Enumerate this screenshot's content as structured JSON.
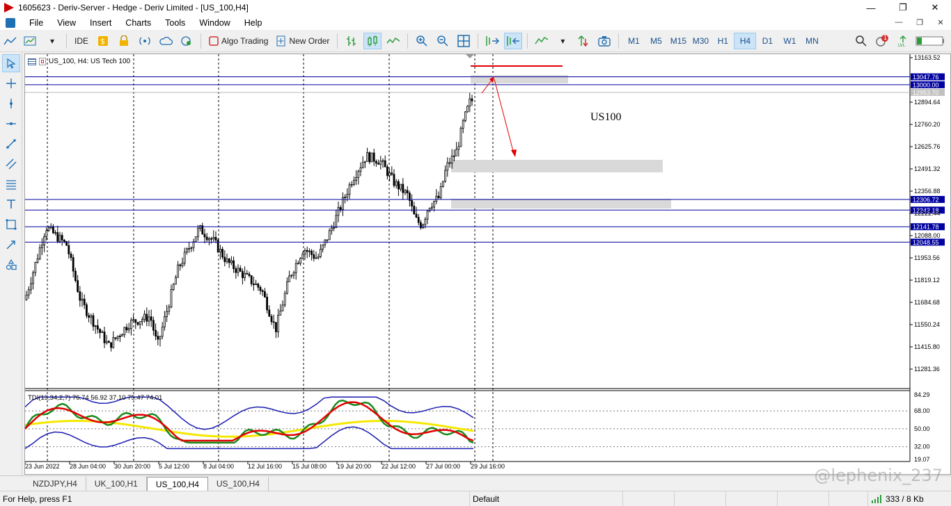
{
  "window": {
    "title": "1605623 - Deriv-Server - Hedge - Deriv Limited - [US_100,H4]"
  },
  "menu": [
    "File",
    "View",
    "Insert",
    "Charts",
    "Tools",
    "Window",
    "Help"
  ],
  "toolbar": {
    "ide_label": "IDE",
    "algo_label": "Algo Trading",
    "new_order_label": "New Order",
    "timeframes": [
      "M1",
      "M5",
      "M15",
      "M30",
      "H1",
      "H4",
      "D1",
      "W1",
      "MN"
    ],
    "active_timeframe": "H4",
    "notification_count": "1"
  },
  "chart": {
    "header": "US_100, H4:  US Tech 100",
    "annotation": "US100",
    "price_labels": [
      "13163.52",
      "12894.64",
      "12760.20",
      "12625.76",
      "12491.32",
      "12356.88",
      "12222.44",
      "12088.00",
      "11953.56",
      "11819.12",
      "11684.68",
      "11550.24",
      "11415.80",
      "11281.36"
    ],
    "line_labels": [
      "13047.76",
      "13000.00",
      "12953.70",
      "12306.72",
      "12242.18",
      "12141.78",
      "12048.55"
    ],
    "time_labels": [
      "23 Jun 2022",
      "28 Jun 04:00",
      "30 Jun 20:00",
      "5 Jul 12:00",
      "8 Jul 04:00",
      "12 Jul 16:00",
      "15 Jul 08:00",
      "19 Jul 20:00",
      "22 Jul 12:00",
      "27 Jul 00:00",
      "29 Jul 16:00"
    ],
    "indicator_header": "TDI(13,34,2,7) 76.74 56.92 37.10 75.47 74.01",
    "indicator_levels": [
      "84.29",
      "68.00",
      "50.00",
      "32.00",
      "19.07"
    ],
    "colors": {
      "hline": "#0000a0",
      "arrow": "#e00000",
      "zone": "#d9d9d9",
      "candle": "#000000"
    }
  },
  "tabs": [
    "NZDJPY,H4",
    "UK_100,H1",
    "US_100,H4",
    "US_100,H4"
  ],
  "active_tab": 2,
  "status": {
    "help": "For Help, press F1",
    "profile": "Default",
    "traffic": "333 / 8 Kb"
  },
  "watermark": "@lephenix_237"
}
